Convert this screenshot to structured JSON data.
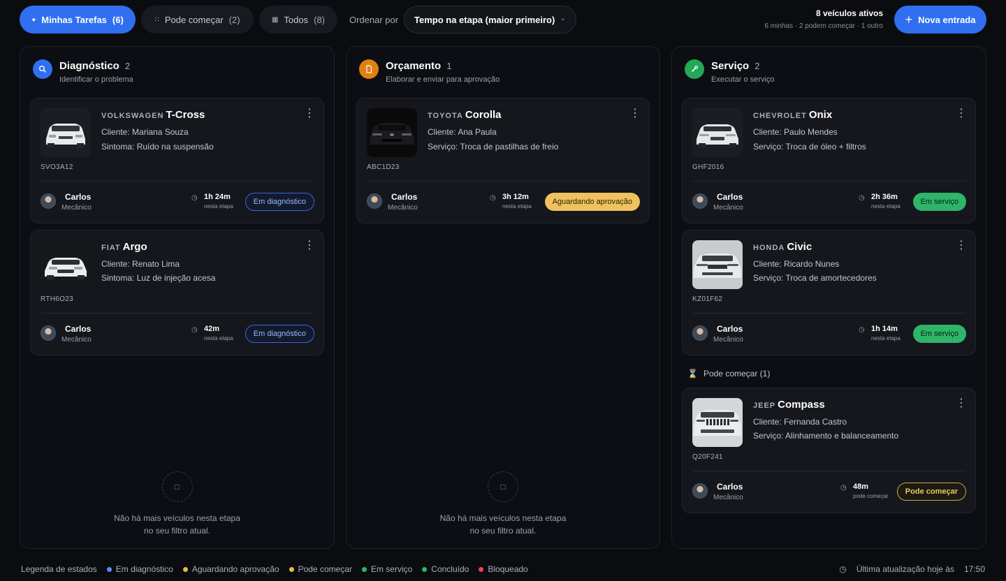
{
  "filters": {
    "tabs": [
      {
        "label": "Minhas Tarefas",
        "count": "(6)"
      },
      {
        "label": "Pode começar",
        "count": "(2)"
      },
      {
        "label": "Todos",
        "count": "(8)"
      }
    ],
    "sort_label": "Ordenar por",
    "sort_value": "Tempo na etapa (maior primeiro)"
  },
  "summary": {
    "active": "8 veículos ativos",
    "detail": "6 minhas · 2 podem começar · 1 outro"
  },
  "new_entry_label": "Nova entrada",
  "colors": {
    "accent": "#2f6ff0",
    "diagnostico": "#2f6ff0",
    "orcamento": "#e0800f",
    "servico": "#23a857"
  },
  "columns": [
    {
      "title": "Diagnóstico",
      "count": "2",
      "subtitle": "Identificar o problema",
      "icon": "search-icon",
      "cards": [
        {
          "brand": "VOLKSWAGEN",
          "model": "T-Cross",
          "client": "Cliente: Mariana Souza",
          "detail": "Sintoma: Ruído na suspensão",
          "plate": "SVO3A12",
          "mechanic": "Carlos",
          "role": "Mecânico",
          "time": "1h 24m",
          "time_label": "nesta etapa",
          "status": "Em diagnóstico"
        },
        {
          "brand": "FIAT",
          "model": "Argo",
          "client": "Cliente: Renato Lima",
          "detail": "Sintoma: Luz de injeção acesa",
          "plate": "RTH6O23",
          "mechanic": "Carlos",
          "role": "Mecânico",
          "time": "42m",
          "time_label": "nesta etapa",
          "status": "Em diagnóstico"
        }
      ],
      "empty_line1": "Não há mais veículos nesta etapa",
      "empty_line2": "no seu filtro atual."
    },
    {
      "title": "Orçamento",
      "count": "1",
      "subtitle": "Elaborar e enviar para aprovação",
      "icon": "document-icon",
      "cards": [
        {
          "brand": "TOYOTA",
          "model": "Corolla",
          "client": "Cliente: Ana Paula",
          "detail": "Serviço: Troca de pastilhas de freio",
          "plate": "ABC1D23",
          "mechanic": "Carlos",
          "role": "Mecânico",
          "time": "3h 12m",
          "time_label": "nesta etapa",
          "status": "Aguardando aprovação"
        }
      ],
      "empty_line1": "Não há mais veículos nesta etapa",
      "empty_line2": "no seu filtro atual."
    },
    {
      "title": "Serviço",
      "count": "2",
      "subtitle": "Executar o serviço",
      "icon": "wrench-icon",
      "cards": [
        {
          "brand": "CHEVROLET",
          "model": "Onix",
          "client": "Cliente: Paulo Mendes",
          "detail": "Serviço: Troca de óleo + filtros",
          "plate": "GHF2016",
          "mechanic": "Carlos",
          "role": "Mecânico",
          "time": "2h 36m",
          "time_label": "nesta etapa",
          "status": "Em serviço"
        },
        {
          "brand": "HONDA",
          "model": "Civic",
          "client": "Cliente: Ricardo Nunes",
          "detail": "Serviço: Troca de amortecedores",
          "plate": "KZ01F62",
          "mechanic": "Carlos",
          "role": "Mecânico",
          "time": "1h 14m",
          "time_label": "nesta etapa",
          "status": "Em serviço"
        }
      ],
      "section_label": "Pode começar (1)",
      "start_cards": [
        {
          "brand": "JEEP",
          "model": "Compass",
          "client": "Cliente: Fernanda Castro",
          "detail": "Serviço: Alinhamento e balanceamento",
          "plate": "Q20F241",
          "mechanic": "Carlos",
          "role": "Mecânico",
          "time": "48m",
          "time_label": "pode começar",
          "status": "Pode começar"
        }
      ]
    }
  ],
  "footer": {
    "legend_title": "Legenda de estados",
    "legend": [
      {
        "label": "Em diagnóstico",
        "color": "#5b8def"
      },
      {
        "label": "Aguardando aprovação",
        "color": "#e9b949"
      },
      {
        "label": "Pode começar",
        "color": "#e9b949"
      },
      {
        "label": "Em serviço",
        "color": "#2fb56a"
      },
      {
        "label": "Concluído",
        "color": "#2fb56a"
      },
      {
        "label": "Bloqueado",
        "color": "#e5484d"
      }
    ],
    "updated": "Última atualização hoje às",
    "time": "17:50"
  }
}
